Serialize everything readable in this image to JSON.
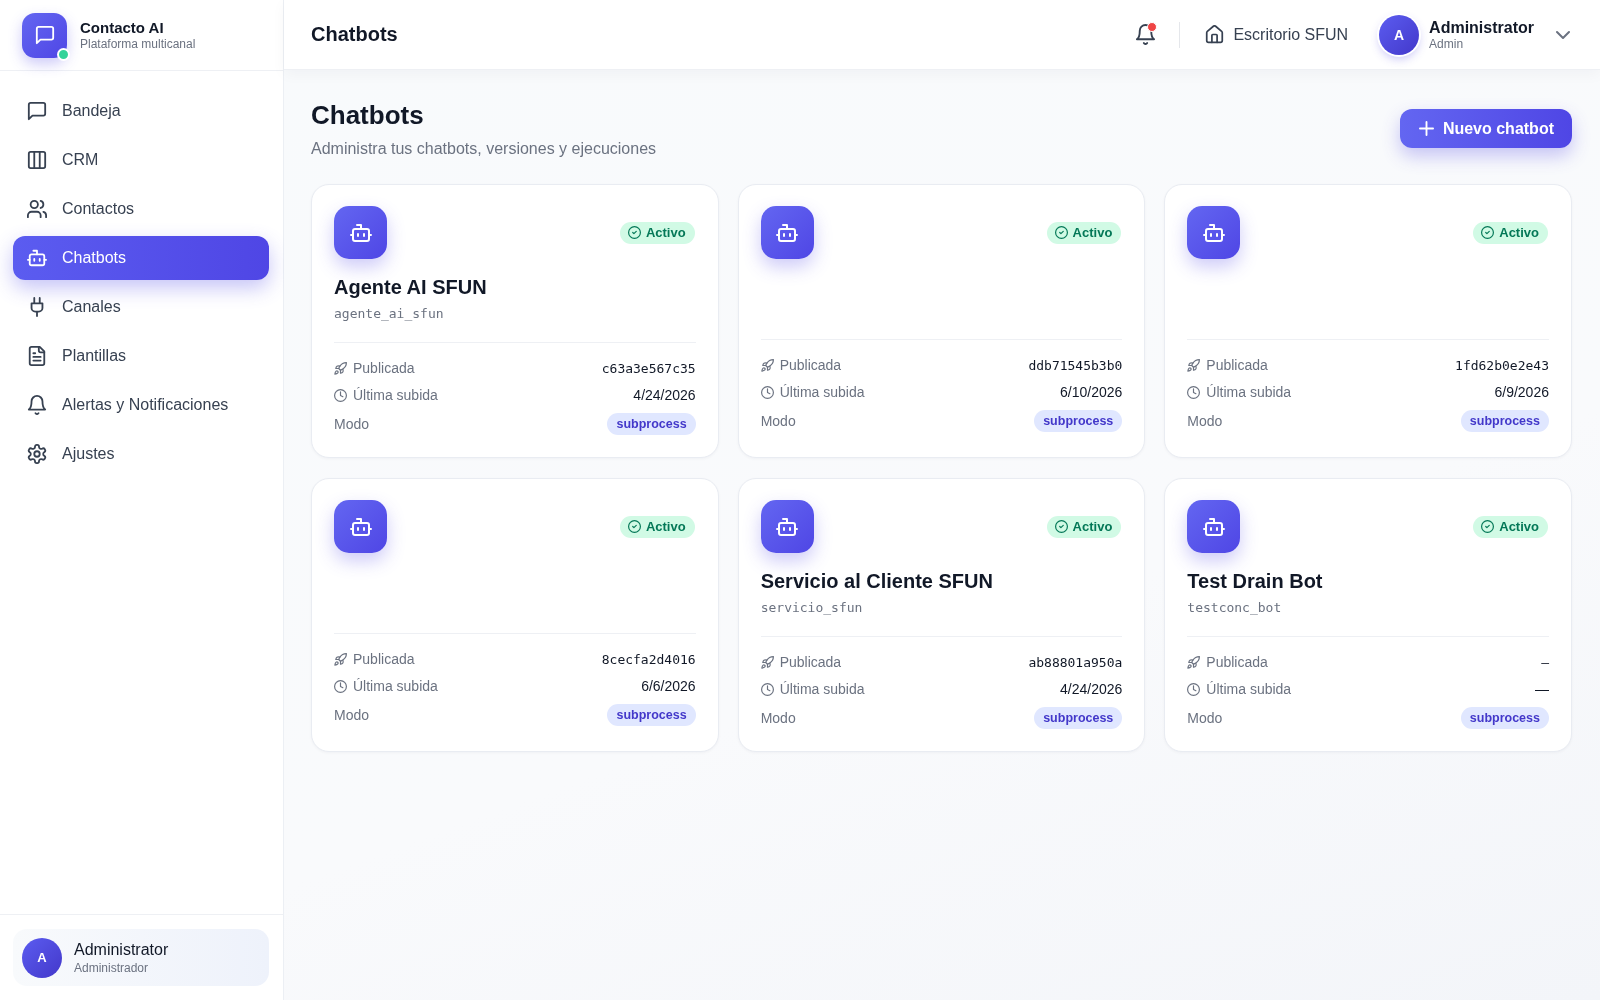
{
  "sidebar": {
    "brand": {
      "title": "Contacto AI",
      "subtitle": "Plataforma multicanal",
      "online": true
    },
    "items": [
      {
        "label": "Bandeja",
        "selected": false
      },
      {
        "label": "CRM",
        "selected": false
      },
      {
        "label": "Contactos",
        "selected": false
      },
      {
        "label": "Chatbots",
        "selected": true
      },
      {
        "label": "Canales",
        "selected": false
      },
      {
        "label": "Plantillas",
        "selected": false
      },
      {
        "label": "Alertas y Notificaciones",
        "selected": false
      },
      {
        "label": "Ajustes",
        "selected": false
      }
    ],
    "user": {
      "avatar": "A",
      "name": "Administrator",
      "role": "Administrador"
    }
  },
  "header": {
    "title": "Chatbots",
    "notifications": {
      "unread": true
    },
    "workspace": "Escritorio SFUN",
    "user": {
      "avatar": "A",
      "name": "Administrator",
      "role": "Admin"
    }
  },
  "page": {
    "title": "Chatbots",
    "subtitle": "Administra tus chatbots, versiones y ejecuciones",
    "new_button": "Nuevo chatbot"
  },
  "chatbots": [
    {
      "name": "Agente AI SFUN",
      "slug": "agente_ai_sfun",
      "status": "Activo",
      "active": true,
      "published_label": "Publicada",
      "published": "c63a3e567c35",
      "uploaded_label": "Última subida",
      "uploaded": "4/24/2026",
      "mode_label": "Modo",
      "mode": "subprocess"
    },
    {
      "status": "Activo",
      "active": true,
      "published_label": "Publicada",
      "published": "ddb71545b3b0",
      "uploaded_label": "Última subida",
      "uploaded": "6/10/2026",
      "mode_label": "Modo",
      "mode": "subprocess"
    },
    {
      "status": "Activo",
      "active": true,
      "published_label": "Publicada",
      "published": "1fd62b0e2e43",
      "uploaded_label": "Última subida",
      "uploaded": "6/9/2026",
      "mode_label": "Modo",
      "mode": "subprocess"
    },
    {
      "status": "Activo",
      "active": true,
      "published_label": "Publicada",
      "published": "8cecfa2d4016",
      "uploaded_label": "Última subida",
      "uploaded": "6/6/2026",
      "mode_label": "Modo",
      "mode": "subprocess"
    },
    {
      "name": "Servicio al Cliente SFUN",
      "slug": "servicio_sfun",
      "status": "Activo",
      "active": true,
      "published_label": "Publicada",
      "published": "ab88801a950a",
      "uploaded_label": "Última subida",
      "uploaded": "4/24/2026",
      "mode_label": "Modo",
      "mode": "subprocess"
    },
    {
      "name": "Test Drain Bot",
      "slug": "testconc_bot",
      "status": "Activo",
      "active": true,
      "published_label": "Publicada",
      "published": "–",
      "uploaded_label": "Última subida",
      "uploaded": "—",
      "mode_label": "Modo",
      "mode": "subprocess"
    }
  ]
}
